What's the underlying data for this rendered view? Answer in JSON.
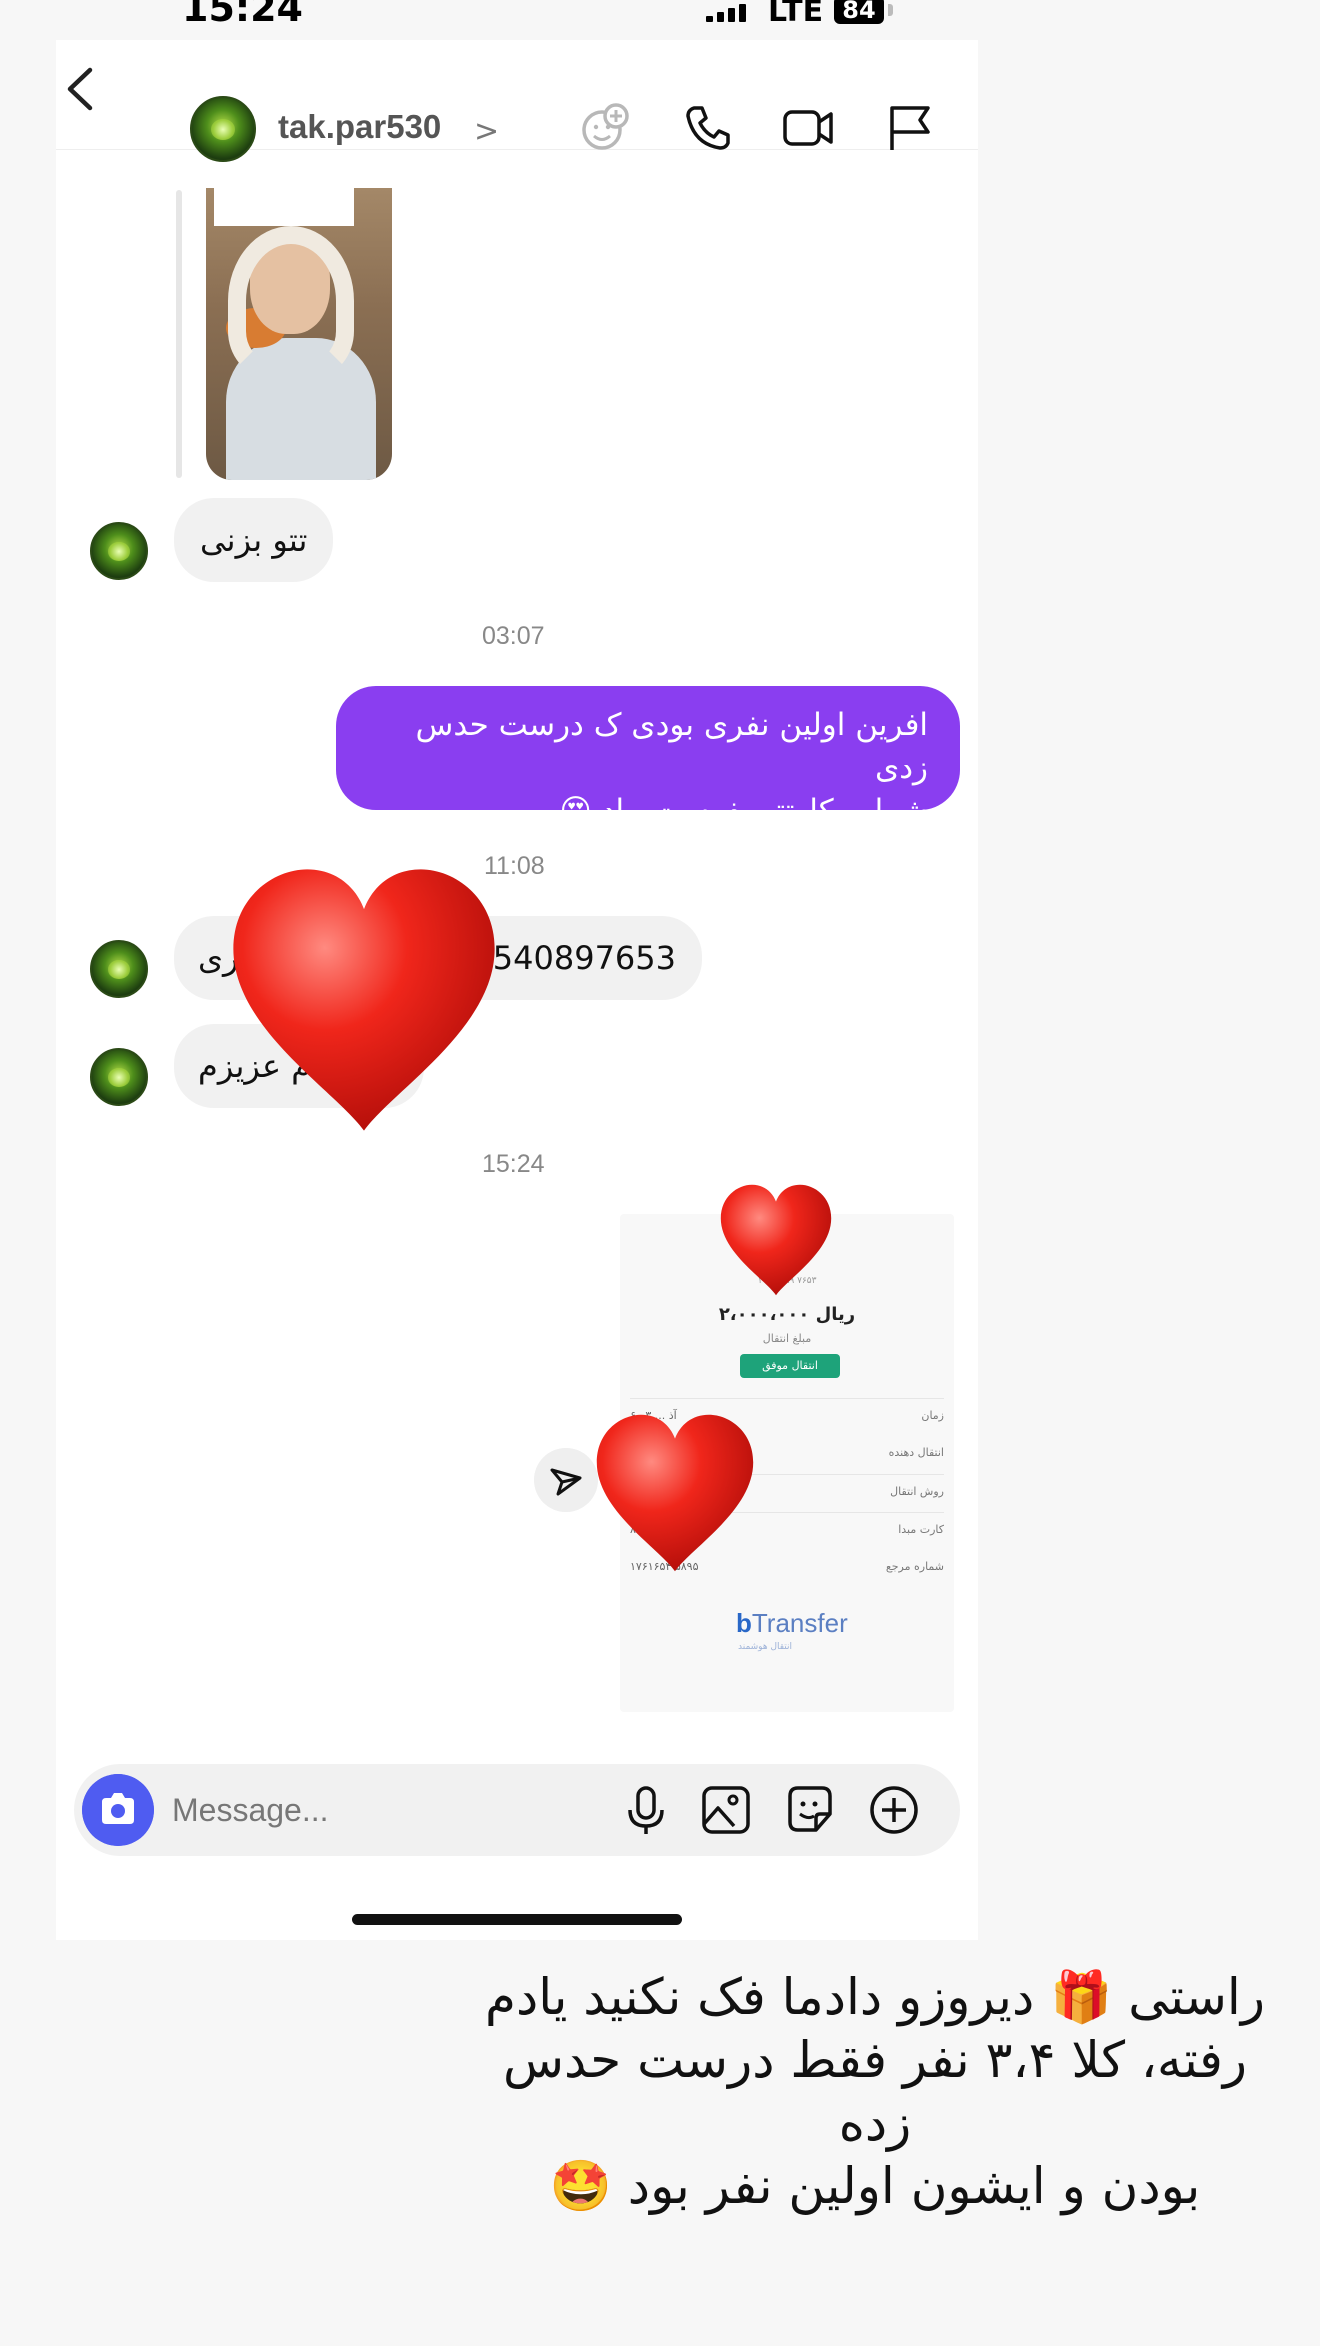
{
  "status_bar": {
    "time": "15:24",
    "network": "LTE",
    "battery": "84"
  },
  "header": {
    "username": "tak.par530",
    "chevron": ">"
  },
  "messages": {
    "msg1": "تتو بزنی",
    "ts1": "03:07",
    "out1_line1": "افرین اولین نفری بودی ک درست حدس زدی",
    "out1_line2": "شماره کارتتو بفرست بیاد 😍",
    "ts2": "11:08",
    "msg2_right": "540897653",
    "msg2_left": "ری",
    "msg3": "م عزیزم",
    "ts3": "15:24"
  },
  "receipt": {
    "top_line": "یو",
    "top_sub": "۱۰۲۰ ۰۸۹ ۷۶۵۳",
    "amount": "۲،۰۰۰،۰۰۰ ریال",
    "amount_label": "مبلغ انتقال",
    "status": "انتقال موفق",
    "rows": [
      {
        "label": "زمان",
        "value": "۶ آذ ... ۰۳"
      },
      {
        "label": "انتقال دهنده",
        "value": ""
      },
      {
        "label": "روش انتقال",
        "value": ""
      },
      {
        "label": "کارت مبدا",
        "value": "۸"
      },
      {
        "label": "شماره مرجع",
        "value": "۱۷۶۱۶۵۴ ۵۸۹۵"
      }
    ],
    "logo_prefix": "b",
    "logo_text": "Transfer",
    "logo_sub": "انتقال هوشمند"
  },
  "composer": {
    "placeholder": "Message..."
  },
  "caption": {
    "line1": "راستی 🎁 دیروزو دادما فک نکنید یادم",
    "line2": "رفته، کلا ۳،۴ نفر فقط درست حدس زده",
    "line3": "بودن و ایشون اولین نفر بود 🤩"
  },
  "colors": {
    "accent": "#8a3ef0",
    "camera": "#4f5cf1",
    "heart": "#e3231c",
    "success": "#1ea37a"
  },
  "icons": [
    "back-icon",
    "avatar",
    "add-effect-icon",
    "phone-icon",
    "video-icon",
    "flag-icon",
    "camera-icon",
    "mic-icon",
    "gallery-icon",
    "sticker-icon",
    "plus-icon",
    "share-icon",
    "heart-icon"
  ]
}
